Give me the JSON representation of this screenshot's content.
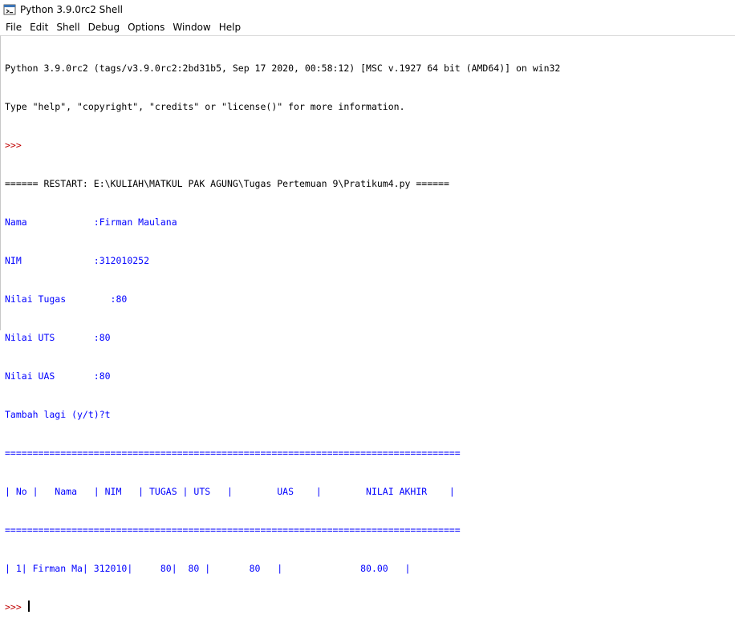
{
  "window": {
    "title": "Python 3.9.0rc2 Shell"
  },
  "menu": [
    "File",
    "Edit",
    "Shell",
    "Debug",
    "Options",
    "Window",
    "Help"
  ],
  "shell": {
    "banner1": "Python 3.9.0rc2 (tags/v3.9.0rc2:2bd31b5, Sep 17 2020, 00:58:12) [MSC v.1927 64 bit (AMD64)] on win32",
    "banner2": "Type \"help\", \"copyright\", \"credits\" or \"license()\" for more information.",
    "prompt": ">>> ",
    "restart": "====== RESTART: E:\\KULIAH\\MATKUL PAK AGUNG\\Tugas Pertemuan 9\\Pratikum4.py ======",
    "lines": [
      "Nama            :Firman Maulana",
      "NIM             :312010252",
      "Nilai Tugas        :80",
      "Nilai UTS       :80",
      "Nilai UAS       :80",
      "Tambah lagi (y/t)?t",
      "==================================================================================",
      "| No |   Nama   | NIM   | TUGAS | UTS   |        UAS    |        NILAI AKHIR    |",
      "==================================================================================",
      "| 1| Firman Ma| 312010|     80|  80 |       80   |              80.00   |"
    ]
  }
}
